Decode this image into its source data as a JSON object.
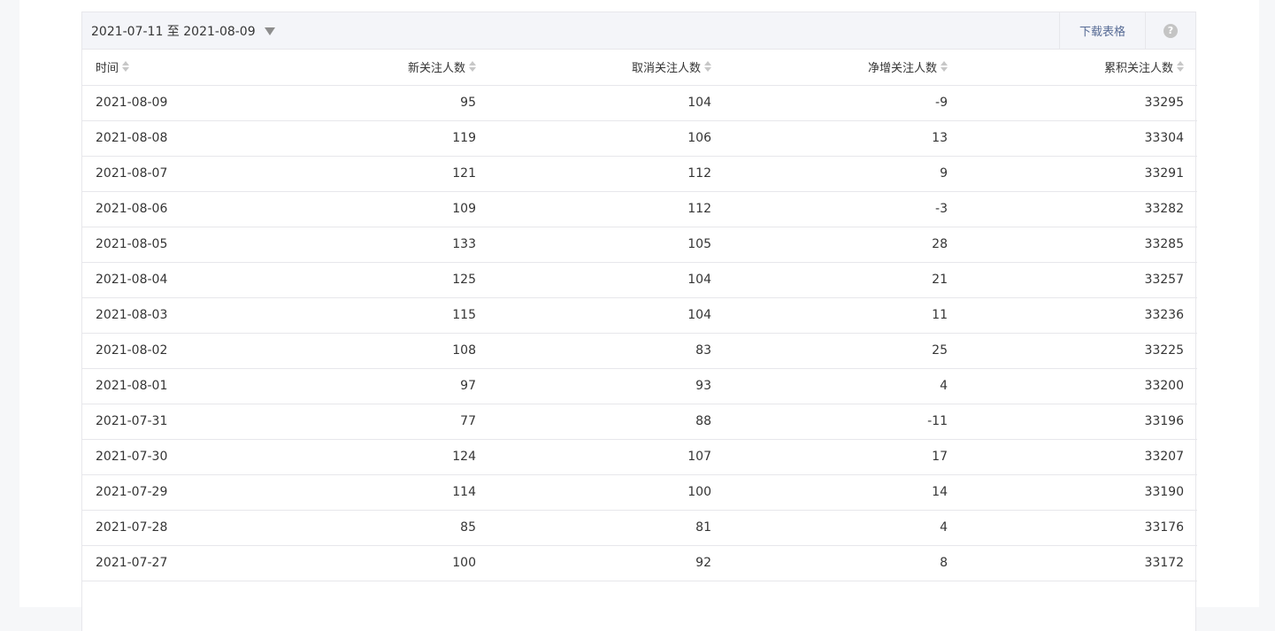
{
  "toolbar": {
    "date_range": "2021-07-11 至 2021-08-09",
    "download_label": "下载表格",
    "help_label": "?"
  },
  "table": {
    "columns": [
      "时间",
      "新关注人数",
      "取消关注人数",
      "净增关注人数",
      "累积关注人数"
    ],
    "rows": [
      [
        "2021-08-09",
        "95",
        "104",
        "-9",
        "33295"
      ],
      [
        "2021-08-08",
        "119",
        "106",
        "13",
        "33304"
      ],
      [
        "2021-08-07",
        "121",
        "112",
        "9",
        "33291"
      ],
      [
        "2021-08-06",
        "109",
        "112",
        "-3",
        "33282"
      ],
      [
        "2021-08-05",
        "133",
        "105",
        "28",
        "33285"
      ],
      [
        "2021-08-04",
        "125",
        "104",
        "21",
        "33257"
      ],
      [
        "2021-08-03",
        "115",
        "104",
        "11",
        "33236"
      ],
      [
        "2021-08-02",
        "108",
        "83",
        "25",
        "33225"
      ],
      [
        "2021-08-01",
        "97",
        "93",
        "4",
        "33200"
      ],
      [
        "2021-07-31",
        "77",
        "88",
        "-11",
        "33196"
      ],
      [
        "2021-07-30",
        "124",
        "107",
        "17",
        "33207"
      ],
      [
        "2021-07-29",
        "114",
        "100",
        "14",
        "33190"
      ],
      [
        "2021-07-28",
        "85",
        "81",
        "4",
        "33176"
      ],
      [
        "2021-07-27",
        "100",
        "92",
        "8",
        "33172"
      ]
    ]
  },
  "colors": {
    "link": "#576b95",
    "border": "#e7e7eb",
    "toolbar_bg": "#f4f5f9"
  }
}
